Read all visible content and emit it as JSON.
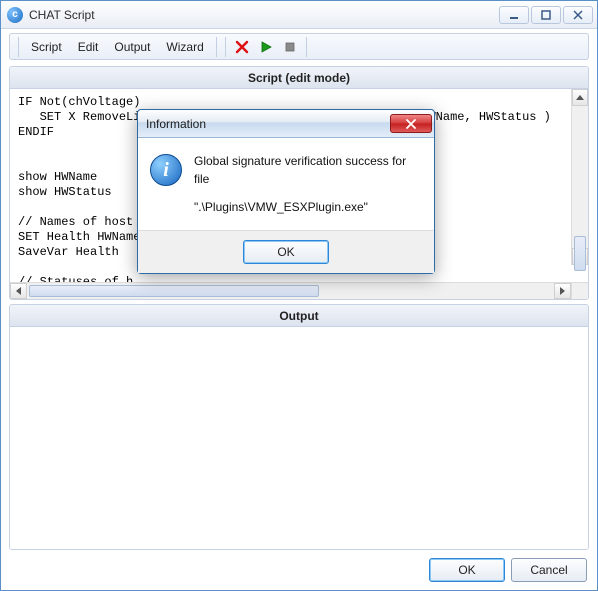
{
  "window": {
    "title": "CHAT Script"
  },
  "menu": {
    "script": "Script",
    "edit": "Edit",
    "output": "Output",
    "wizard": "Wizard"
  },
  "sections": {
    "script_header": "Script (edit mode)",
    "output_header": "Output"
  },
  "code": "IF Not(chVoltage)\n   SET X RemoveLines( CmpText( HWName,\"<>\",\"Voltage\" ), HWName, HWStatus )\nENDIF\n\n\nshow HWName\nshow HWStatus\n\n// Names of host\nSET Health HWName\nSaveVar Health\n\n// Statuses of h\nSaveVar HWStatus",
  "buttons": {
    "ok": "OK",
    "cancel": "Cancel"
  },
  "dialog": {
    "title": "Information",
    "line1": "Global signature verification success for file",
    "line2": "\".\\Plugins\\VMW_ESXPlugin.exe\"",
    "ok": "OK"
  }
}
